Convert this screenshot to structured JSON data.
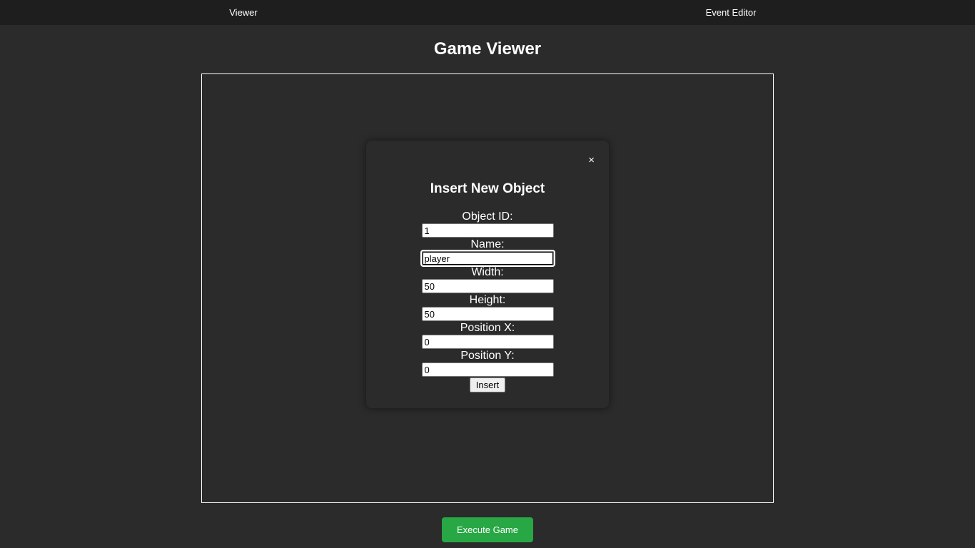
{
  "nav": {
    "viewer_label": "Viewer",
    "editor_label": "Event Editor"
  },
  "page": {
    "title": "Game Viewer"
  },
  "modal": {
    "close_label": "×",
    "title": "Insert New Object",
    "fields": [
      {
        "label": "Object ID:",
        "value": "1"
      },
      {
        "label": "Name:",
        "value": "player"
      },
      {
        "label": "Width:",
        "value": "50"
      },
      {
        "label": "Height:",
        "value": "50"
      },
      {
        "label": "Position X:",
        "value": "0"
      },
      {
        "label": "Position Y:",
        "value": "0"
      }
    ],
    "insert_label": "Insert"
  },
  "footer": {
    "execute_label": "Execute Game"
  },
  "colors": {
    "background": "#2b2b2b",
    "nav_background": "#1e1e1e",
    "execute_button": "#28a745"
  }
}
